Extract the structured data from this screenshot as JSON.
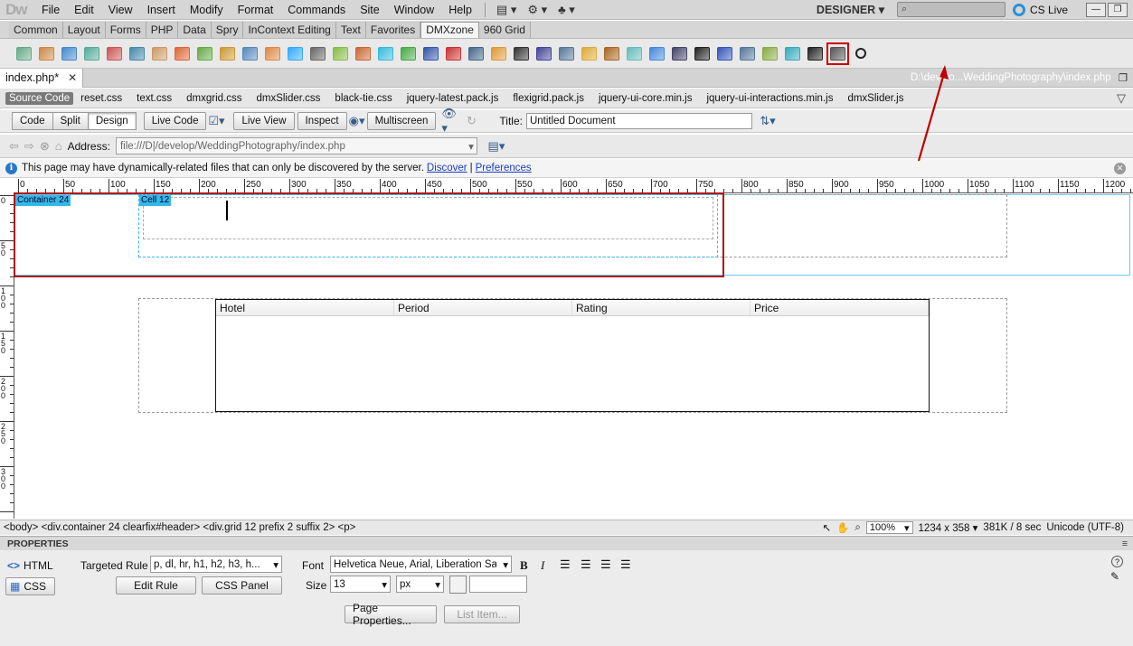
{
  "app": {
    "logo": "Dw",
    "workspace": "DESIGNER",
    "cs_live": "CS Live"
  },
  "menu": [
    "File",
    "Edit",
    "View",
    "Insert",
    "Modify",
    "Format",
    "Commands",
    "Site",
    "Window",
    "Help"
  ],
  "insert_tabs": {
    "items": [
      "Common",
      "Layout",
      "Forms",
      "PHP",
      "Data",
      "Spry",
      "InContext Editing",
      "Text",
      "Favorites",
      "DMXzone",
      "960 Grid"
    ],
    "active": "DMXzone"
  },
  "document": {
    "tab_label": "index.php*",
    "path": "D:\\develo...WeddingPhotography\\index.php"
  },
  "related_files": [
    "Source Code",
    "reset.css",
    "text.css",
    "dmxgrid.css",
    "dmxSlider.css",
    "black-tie.css",
    "jquery-latest.pack.js",
    "flexigrid.pack.js",
    "jquery-ui-core.min.js",
    "jquery-ui-interactions.min.js",
    "dmxSlider.js"
  ],
  "doc_toolbar": {
    "code": "Code",
    "split": "Split",
    "design": "Design",
    "live_code": "Live Code",
    "live_view": "Live View",
    "inspect": "Inspect",
    "multiscreen": "Multiscreen",
    "title_label": "Title:",
    "title_value": "Untitled Document"
  },
  "address": {
    "label": "Address:",
    "value": "file:///D|/develop/WeddingPhotography/index.php"
  },
  "info": {
    "message": "This page may have dynamically-related files that can only be discovered by the server.",
    "discover": "Discover",
    "divider": "|",
    "preferences": "Preferences"
  },
  "ruler": {
    "labels": [
      "0",
      "50",
      "100",
      "150",
      "200",
      "250",
      "300",
      "350",
      "400",
      "450",
      "500",
      "550",
      "600",
      "650",
      "700",
      "750",
      "800",
      "850",
      "900",
      "950",
      "1000",
      "1050",
      "1100",
      "1150",
      "1200"
    ],
    "vlabels": [
      "0",
      "50",
      "100",
      "150",
      "200",
      "250",
      "300"
    ]
  },
  "design": {
    "container_tag": "Container 24",
    "cell_tag": "Cell 12",
    "table_headers": [
      "Hotel",
      "Period",
      "Rating",
      "Price"
    ]
  },
  "status": {
    "tag_selector": "<body> <div.container  24 clearfix#header> <div.grid  12 prefix  2 suffix  2> <p>",
    "zoom": "100%",
    "window_size": "1234 x 358",
    "download": "381K / 8 sec",
    "encoding": "Unicode (UTF-8)"
  },
  "properties": {
    "header": "PROPERTIES",
    "html_label": "HTML",
    "css_label": "CSS",
    "targeted_rule_label": "Targeted Rule",
    "targeted_rule_value": "p, dl, hr, h1, h2, h3, h...",
    "edit_rule": "Edit Rule",
    "css_panel": "CSS Panel",
    "font_label": "Font",
    "font_value": "Helvetica Neue, Arial, Liberation Sans",
    "size_label": "Size",
    "size_value": "13",
    "unit_value": "px",
    "page_properties": "Page Properties...",
    "list_item": "List Item..."
  },
  "colors": {
    "highlight_red": "#c00000",
    "tag_blue": "#34b8e8",
    "link_blue": "#1a3ec8"
  }
}
